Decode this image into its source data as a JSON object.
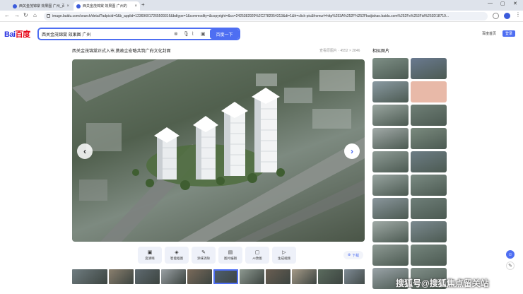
{
  "browser": {
    "tabs": [
      {
        "label": "西关金茂锦棠 效果图 广州_百"
      },
      {
        "label": "西关金茂锦棠 效果图 广州的"
      }
    ],
    "url": "image.baidu.com/search/detail?adpicid=0&b_applid=123696017265509316&bdtype=1&commodity=&copyright=&cs=2425382920%2C2782054313&di=1&fr=click-pic&fromurl=http%253A%252F%252Fbaijiahao.baidu.com%252Fs%253Fid%253D18719..."
  },
  "header": {
    "logo_text": "Bai",
    "logo_paw": "百度",
    "search_value": "西关金茂锦棠 效果图 广州",
    "search_button": "百度一下",
    "home_link": "百度首页",
    "login_button": "登录"
  },
  "viewer": {
    "title": "西关金茂锦棠正式入市,携政企宏略共筑广府文化封面",
    "meta": "查看原图片 · 4552 × 2846",
    "prev_arrow": "‹",
    "next_arrow": "›"
  },
  "tools": [
    {
      "icon": "▣",
      "label": "变清晰",
      "name": "tool-enhance"
    },
    {
      "icon": "◈",
      "label": "智能抠图",
      "name": "tool-cutout"
    },
    {
      "icon": "✎",
      "label": "涂抹消除",
      "name": "tool-erase"
    },
    {
      "icon": "▤",
      "label": "图片编辑",
      "name": "tool-edit"
    },
    {
      "icon": "▢",
      "label": "AI改图",
      "name": "tool-ai-edit"
    },
    {
      "icon": "▷",
      "label": "生成视频",
      "name": "tool-video"
    }
  ],
  "download_label": "下载",
  "related": {
    "title": "相似图片",
    "count": 20
  },
  "watermark": "搜狐号@搜狐焦点留关站",
  "colors": {
    "accent": "#4e6ef2",
    "logo_blue": "#2932e1",
    "logo_red": "#e60012"
  }
}
